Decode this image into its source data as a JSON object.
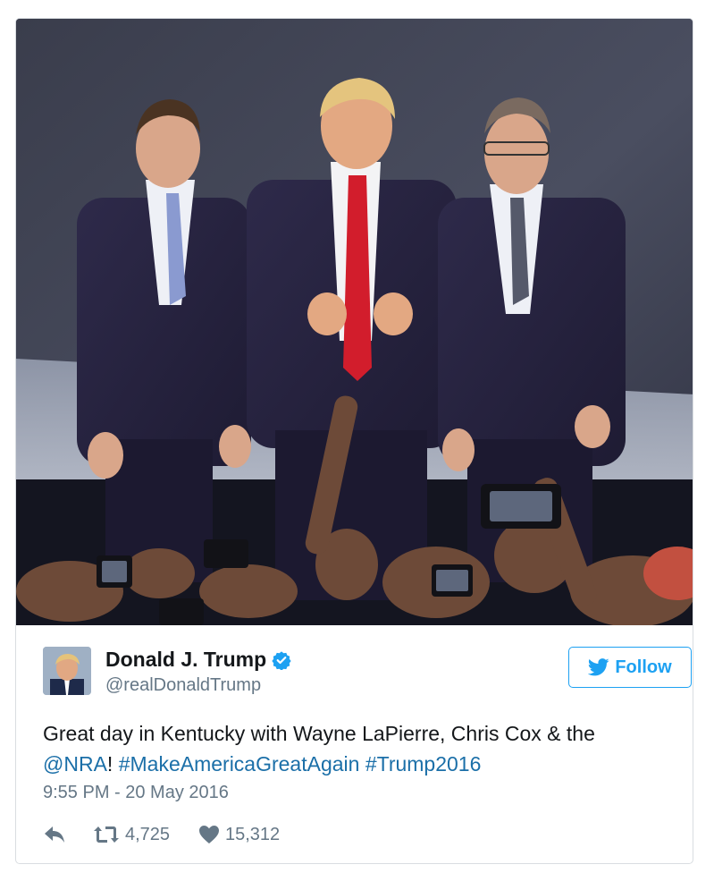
{
  "author": {
    "name": "Donald J. Trump",
    "handle": "@realDonaldTrump",
    "verified": true,
    "avatar_icon": "profile-photo"
  },
  "follow_button": {
    "label": "Follow",
    "icon": "twitter-bird-icon"
  },
  "tweet": {
    "text_plain": "Great day in Kentucky with Wayne LaPierre, Chris Cox & the",
    "mention": "@NRA",
    "exclamation": "!",
    "hashtag_1": "#MakeAmericaGreatAgain",
    "hashtag_2": "#Trump2016"
  },
  "timestamp": "9:55 PM - 20 May 2016",
  "actions": {
    "reply_icon": "reply-icon",
    "retweet_icon": "retweet-icon",
    "retweet_count": "4,725",
    "like_icon": "heart-icon",
    "like_count": "15,312"
  },
  "colors": {
    "link": "#1b6fa8",
    "twitter_blue": "#1da1f2",
    "secondary_text": "#657786",
    "primary_text": "#14171a"
  }
}
